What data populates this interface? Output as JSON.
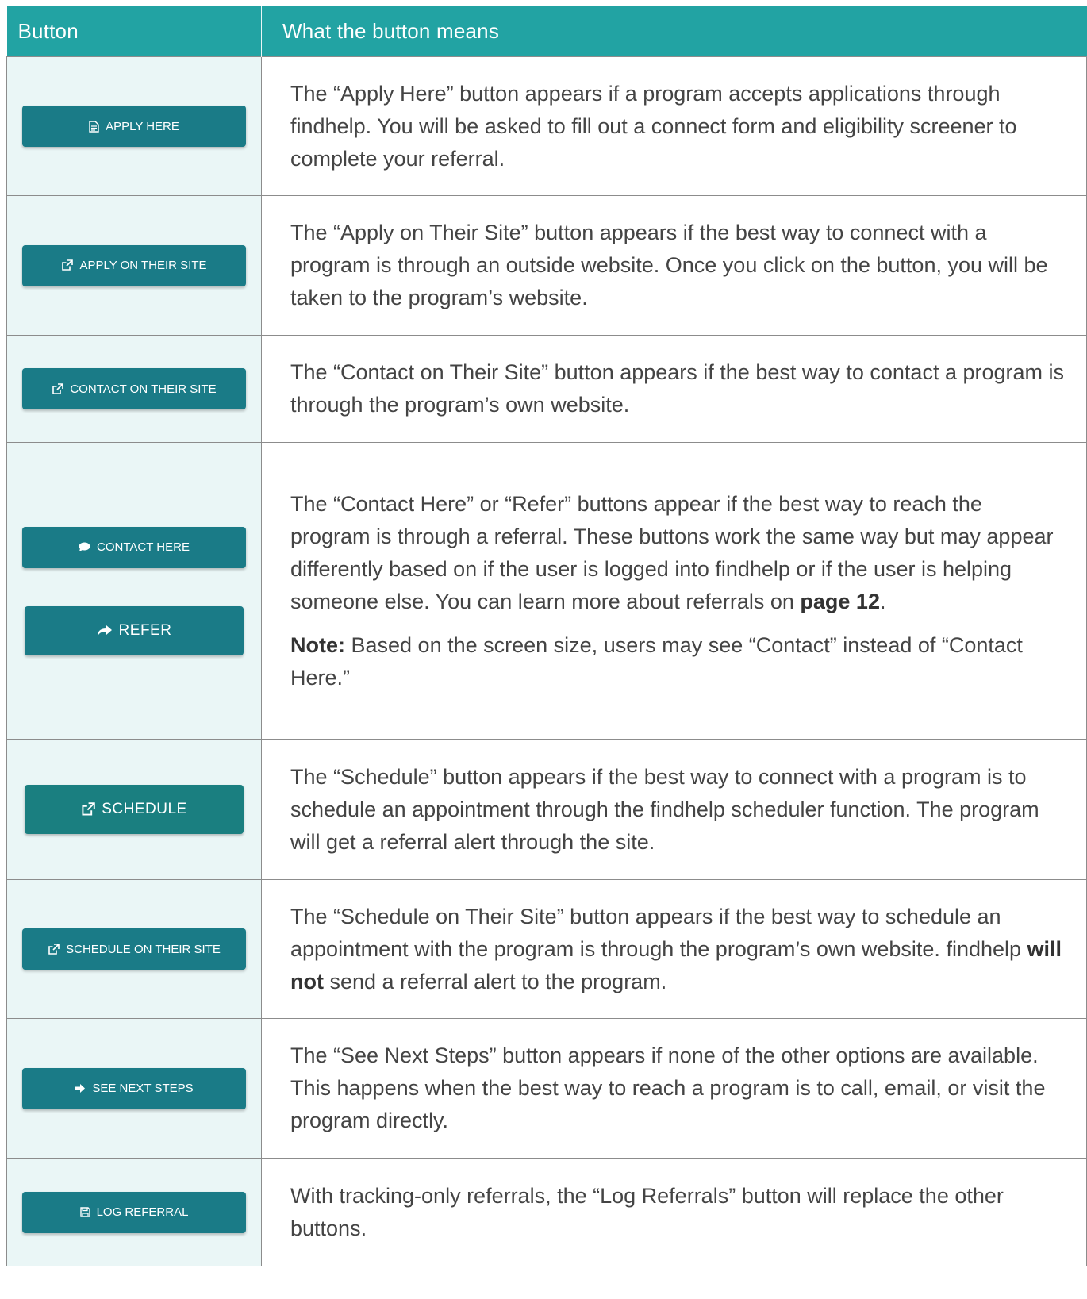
{
  "header": {
    "col1": "Button",
    "col2": "What the button means"
  },
  "rows": [
    {
      "button": "APPLY HERE",
      "icon": "document-icon",
      "text": "The “Apply Here” button appears if a program accepts applications through findhelp. You will be asked to fill out a connect form and eligibility screener to complete your referral."
    },
    {
      "button": "APPLY ON THEIR SITE",
      "icon": "external-link-icon",
      "text": "The “Apply on Their Site” button appears if the best way to connect with a program is through an outside website. Once you click on the button, you will be taken to the program’s website."
    },
    {
      "button": "CONTACT ON THEIR SITE",
      "icon": "external-link-icon",
      "text": "The “Contact on Their Site” button appears if the best way to contact a program is through the program’s own website."
    },
    {
      "button": "CONTACT HERE",
      "icon": "chat-bubble-icon",
      "button2": "REFER",
      "icon2": "share-arrow-icon",
      "text_before": "The “Contact Here” or “Refer” buttons appear if the best way to reach the program is through a referral. These buttons work the same way but may appear differently based on if the user is logged into findhelp or if the user is helping someone else. You can learn more about referrals on ",
      "text_bold": "page 12",
      "text_after": ".",
      "note_label": "Note:",
      "note_text": " Based on the screen size, users may see “Contact” instead of “Contact Here.”"
    },
    {
      "button": "SCHEDULE",
      "icon": "external-link-icon",
      "text": "The “Schedule” button appears if the best way to connect with a program is to schedule an appointment through the findhelp scheduler function. The program will get a referral alert through the site."
    },
    {
      "button": "SCHEDULE ON THEIR SITE",
      "icon": "external-link-icon",
      "text_before": "The “Schedule on Their Site” button appears if the best way to schedule an appointment with the program is through the program’s own website. findhelp ",
      "text_bold": "will not",
      "text_after": " send a referral alert to the program."
    },
    {
      "button": "SEE NEXT STEPS",
      "icon": "arrow-right-icon",
      "text": "The “See Next Steps” button appears if none of the other options are available. This happens when the best way to reach a program is to call, email, or visit the program directly."
    },
    {
      "button": "LOG REFERRAL",
      "icon": "save-icon",
      "text": "With tracking-only referrals, the “Log Referrals” button will replace the other buttons."
    }
  ],
  "colors": {
    "header_bg": "#22a3a3",
    "button_bg": "#1a7b87",
    "button_cell_bg": "#eaf6f6",
    "border": "#8c8c8c"
  }
}
